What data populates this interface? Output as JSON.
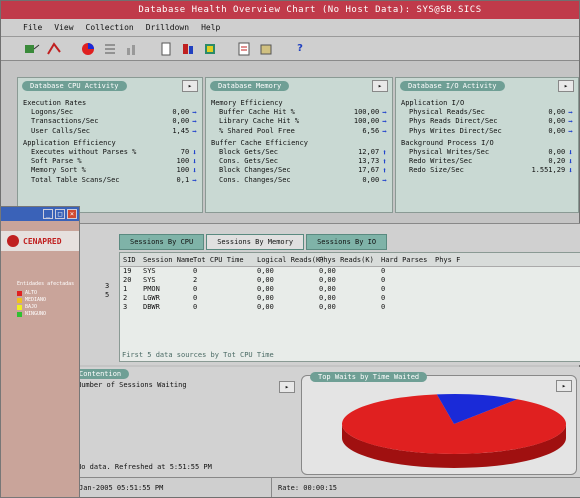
{
  "window": {
    "title": "Database Health Overview Chart (No Host Data): SYS@SB.SICS"
  },
  "menu": [
    "File",
    "View",
    "Collection",
    "Drilldown",
    "Help"
  ],
  "toolbar_icons": [
    "connect-icon",
    "disconnect-icon",
    "chart-icon",
    "list-icon",
    "bar-icon",
    "doc-icon",
    "flag-icon",
    "db-icon",
    "report-icon",
    "export-icon",
    "help-icon"
  ],
  "panels": {
    "cpu": {
      "title": "Database CPU Activity",
      "groups": [
        {
          "title": "Execution Rates",
          "rows": [
            {
              "label": "Logons/Sec",
              "value": "0,00",
              "dir": "right"
            },
            {
              "label": "Transactions/Sec",
              "value": "0,00",
              "dir": "right"
            },
            {
              "label": "User Calls/Sec",
              "value": "1,45",
              "dir": "right"
            }
          ]
        },
        {
          "title": "Application Efficiency",
          "rows": [
            {
              "label": "Executes without Parses %",
              "value": "70",
              "dir": "down"
            },
            {
              "label": "Soft Parse %",
              "value": "100",
              "dir": "down"
            },
            {
              "label": "Memory Sort %",
              "value": "100",
              "dir": "down"
            },
            {
              "label": "Total Table Scans/Sec",
              "value": "0,1",
              "dir": "right"
            }
          ]
        }
      ]
    },
    "memory": {
      "title": "Database Memory",
      "groups": [
        {
          "title": "Memory Efficiency",
          "rows": [
            {
              "label": "Buffer Cache Hit %",
              "value": "100,00",
              "dir": "right"
            },
            {
              "label": "Library Cache Hit %",
              "value": "100,00",
              "dir": "right"
            },
            {
              "label": "% Shared Pool Free",
              "value": "6,56",
              "dir": "right"
            }
          ]
        },
        {
          "title": "Buffer Cache Efficiency",
          "rows": [
            {
              "label": "Block Gets/Sec",
              "value": "12,07",
              "dir": "up"
            },
            {
              "label": "Cons. Gets/Sec",
              "value": "13,73",
              "dir": "up"
            },
            {
              "label": "Block Changes/Sec",
              "value": "17,67",
              "dir": "up"
            },
            {
              "label": "Cons. Changes/Sec",
              "value": "0,00",
              "dir": "right"
            }
          ]
        }
      ]
    },
    "io": {
      "title": "Database I/O Activity",
      "groups": [
        {
          "title": "Application I/O",
          "rows": [
            {
              "label": "Physical Reads/Sec",
              "value": "0,00",
              "dir": "right"
            },
            {
              "label": "Phys Reads Direct/Sec",
              "value": "0,00",
              "dir": "right"
            },
            {
              "label": "Phys Writes Direct/Sec",
              "value": "0,00",
              "dir": "right"
            }
          ]
        },
        {
          "title": "Background Process I/O",
          "rows": [
            {
              "label": "Physical Writes/Sec",
              "value": "0,00",
              "dir": "down"
            },
            {
              "label": "Redo Writes/Sec",
              "value": "0,20",
              "dir": "down"
            },
            {
              "label": "Redo Size/Sec",
              "value": "1.551,29",
              "dir": "down"
            }
          ]
        }
      ]
    }
  },
  "sessions": {
    "tabs": [
      "Sessions By CPU",
      "Sessions By Memory",
      "Sessions By IO"
    ],
    "active_tab": 1,
    "columns": [
      "SID",
      "Session Name",
      "Tot CPU Time",
      "Logical Reads(K)",
      "Phys Reads(K)",
      "Hard Parses",
      "Phys F"
    ],
    "rows": [
      [
        "19",
        "SYS",
        "0",
        "0,00",
        "0,00",
        "0"
      ],
      [
        "20",
        "SYS",
        "2",
        "0,00",
        "0,00",
        "0"
      ],
      [
        "1",
        "PMON",
        "0",
        "0,00",
        "0,00",
        "0"
      ],
      [
        "2",
        "LGWR",
        "0",
        "0,00",
        "0,00",
        "0"
      ],
      [
        "3",
        "DBWR",
        "0",
        "0,00",
        "0,00",
        "0"
      ]
    ],
    "side_numbers": [
      "3",
      "5"
    ],
    "footer": "First 5 data sources by Tot CPU Time"
  },
  "contention": {
    "title": "Contention",
    "text": "Number of Sessions Waiting",
    "status": "No data. Refreshed at 5:51:55 PM"
  },
  "top_waits": {
    "title": "Top Waits by Time Waited",
    "slices": [
      {
        "name": "",
        "value": 88,
        "color": "#e02020"
      },
      {
        "name": "",
        "value": 12,
        "color": "#1a2ad8"
      }
    ]
  },
  "statusbar": {
    "time": "Jan-2005 05:51:55 PM",
    "rate": "Rate: 00:00:15"
  },
  "subwindow": {
    "brand": "CENAPRED",
    "legend_title": "Entidades afectadas",
    "legend": [
      {
        "label": "ALTO",
        "color": "#e02020"
      },
      {
        "label": "MEDIANO",
        "color": "#f0c020"
      },
      {
        "label": "BAJO",
        "color": "#f0f020"
      },
      {
        "label": "NINGUNO",
        "color": "#30c030"
      }
    ]
  }
}
